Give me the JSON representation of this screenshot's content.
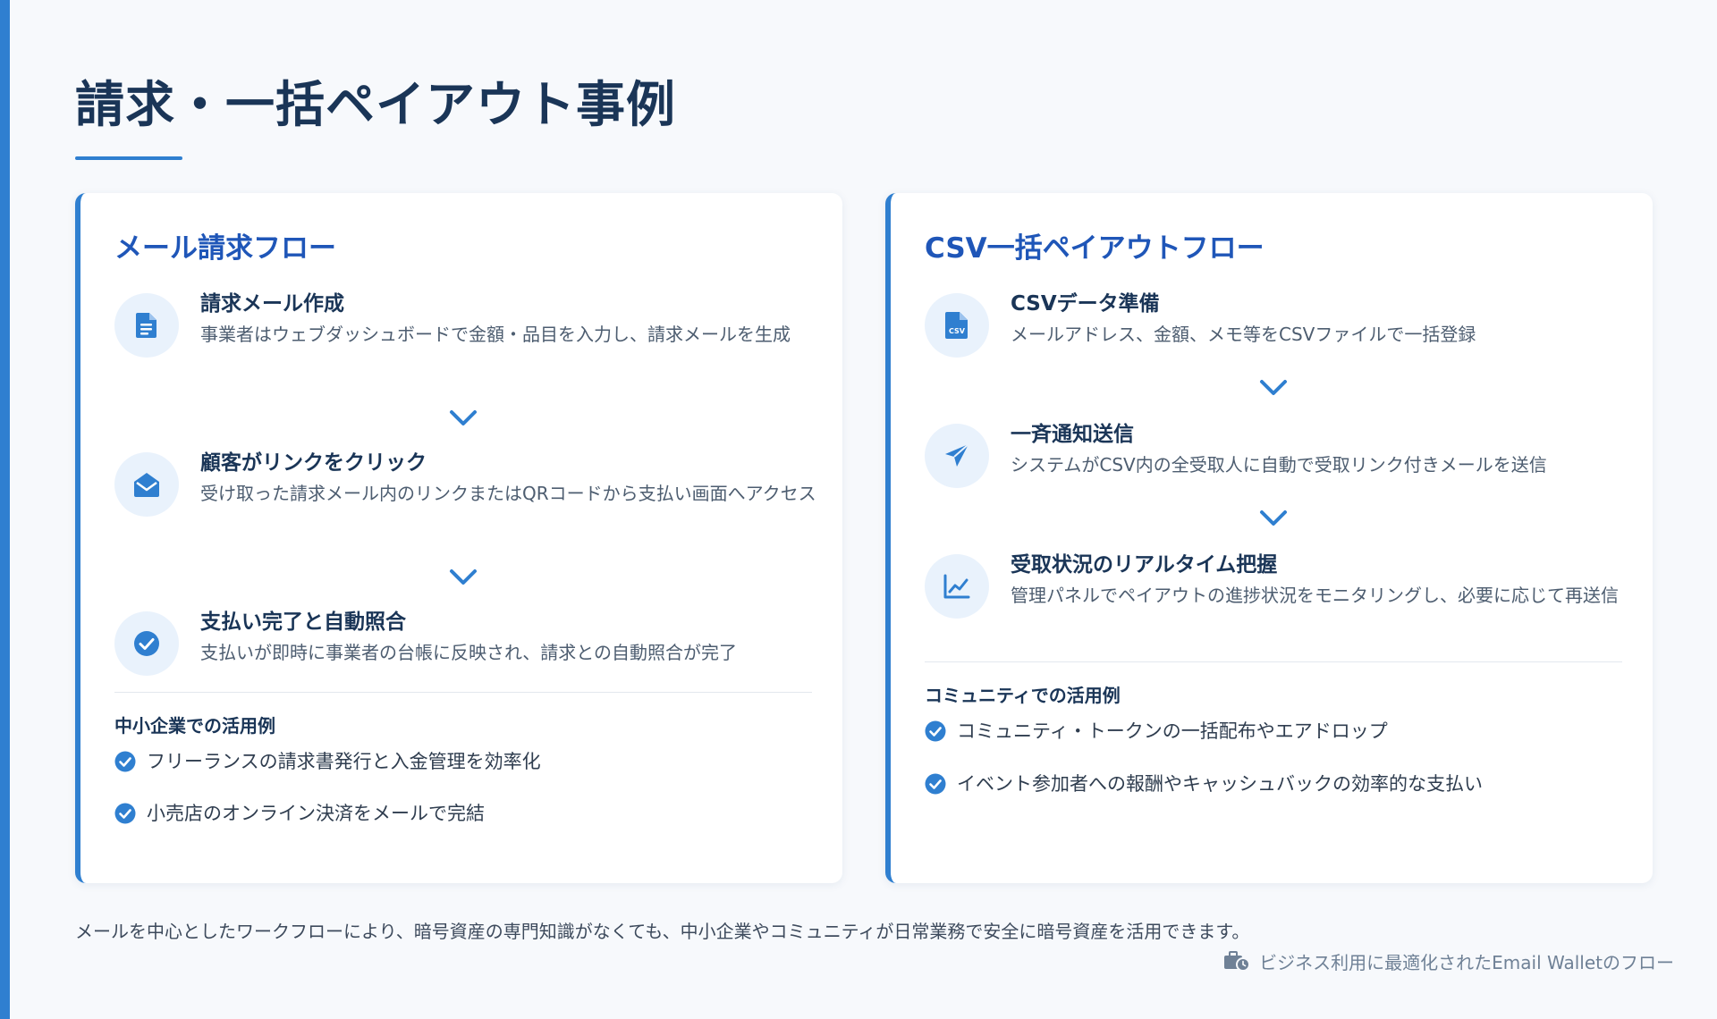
{
  "page": {
    "title": "請求・一括ペイアウト事例",
    "accent_color": "#2f7fd0",
    "title_color": "#1f56b8"
  },
  "invoice_card": {
    "title": "メール請求フロー",
    "steps": [
      {
        "icon": "document-icon",
        "title": "請求メール作成",
        "desc": "事業者はウェブダッシュボードで金額・品目を入力し、請求メールを生成"
      },
      {
        "icon": "open-envelope-icon",
        "title": "顧客がリンクをクリック",
        "desc": "受け取った請求メール内のリンクまたはQRコードから支払い画面へアクセス"
      },
      {
        "icon": "check-circle-icon",
        "title": "支払い完了と自動照合",
        "desc": "支払いが即時に事業者の台帳に反映され、請求との自動照合が完了"
      }
    ],
    "usecase_title": "中小企業での活用例",
    "usecases": [
      "フリーランスの請求書発行と入金管理を効率化",
      "小売店のオンライン決済をメールで完結"
    ]
  },
  "payout_card": {
    "title": "CSV一括ペイアウトフロー",
    "steps": [
      {
        "icon": "csv-file-icon",
        "title": "CSVデータ準備",
        "desc": "メールアドレス、金額、メモ等をCSVファイルで一括登録"
      },
      {
        "icon": "paper-plane-icon",
        "title": "一斉通知送信",
        "desc": "システムがCSV内の全受取人に自動で受取リンク付きメールを送信"
      },
      {
        "icon": "line-chart-icon",
        "title": "受取状況のリアルタイム把握",
        "desc": "管理パネルでペイアウトの進捗状況をモニタリングし、必要に応じて再送信"
      }
    ],
    "usecase_title": "コミュニティでの活用例",
    "usecases": [
      "コミュニティ・トークンの一括配布やエアドロップ",
      "イベント参加者への報酬やキャッシュバックの効率的な支払い"
    ]
  },
  "footer": {
    "text": "メールを中心としたワークフローにより、暗号資産の専門知識がなくても、中小企業やコミュニティが日常業務で安全に暗号資産を活用できます。",
    "note_icon": "business-time-icon",
    "note": "ビジネス利用に最適化されたEmail Walletのフロー"
  }
}
